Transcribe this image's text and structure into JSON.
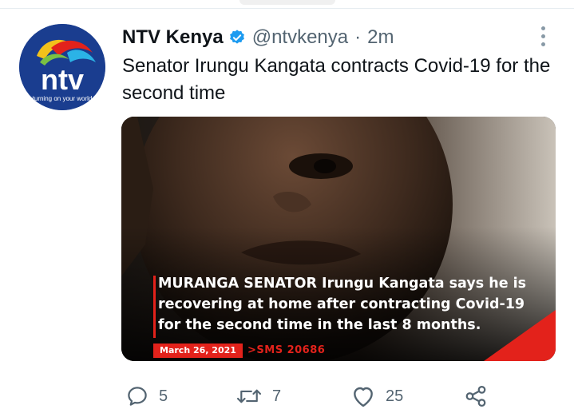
{
  "tweet": {
    "author": {
      "display_name": "NTV Kenya",
      "handle": "@ntvkenya",
      "verified": true,
      "avatar_logo_text": "ntv",
      "avatar_tagline": "turning on your world"
    },
    "separator": "·",
    "timestamp": "2m",
    "text": "Senator Irungu Kangata contracts Covid-19 for the second time",
    "media": {
      "caption_lead": "MURANGA SENATOR",
      "caption_rest": " Irungu Kangata says he is recovering at home after contracting Covid-19 for the second time in the last 8 months.",
      "date": "March 26, 2021",
      "sms": ">SMS 20686"
    },
    "actions": {
      "reply_count": "5",
      "retweet_count": "7",
      "like_count": "25"
    }
  },
  "colors": {
    "brand_red": "#e3221b",
    "verified_blue": "#1d9bf0",
    "muted_text": "#536471"
  }
}
